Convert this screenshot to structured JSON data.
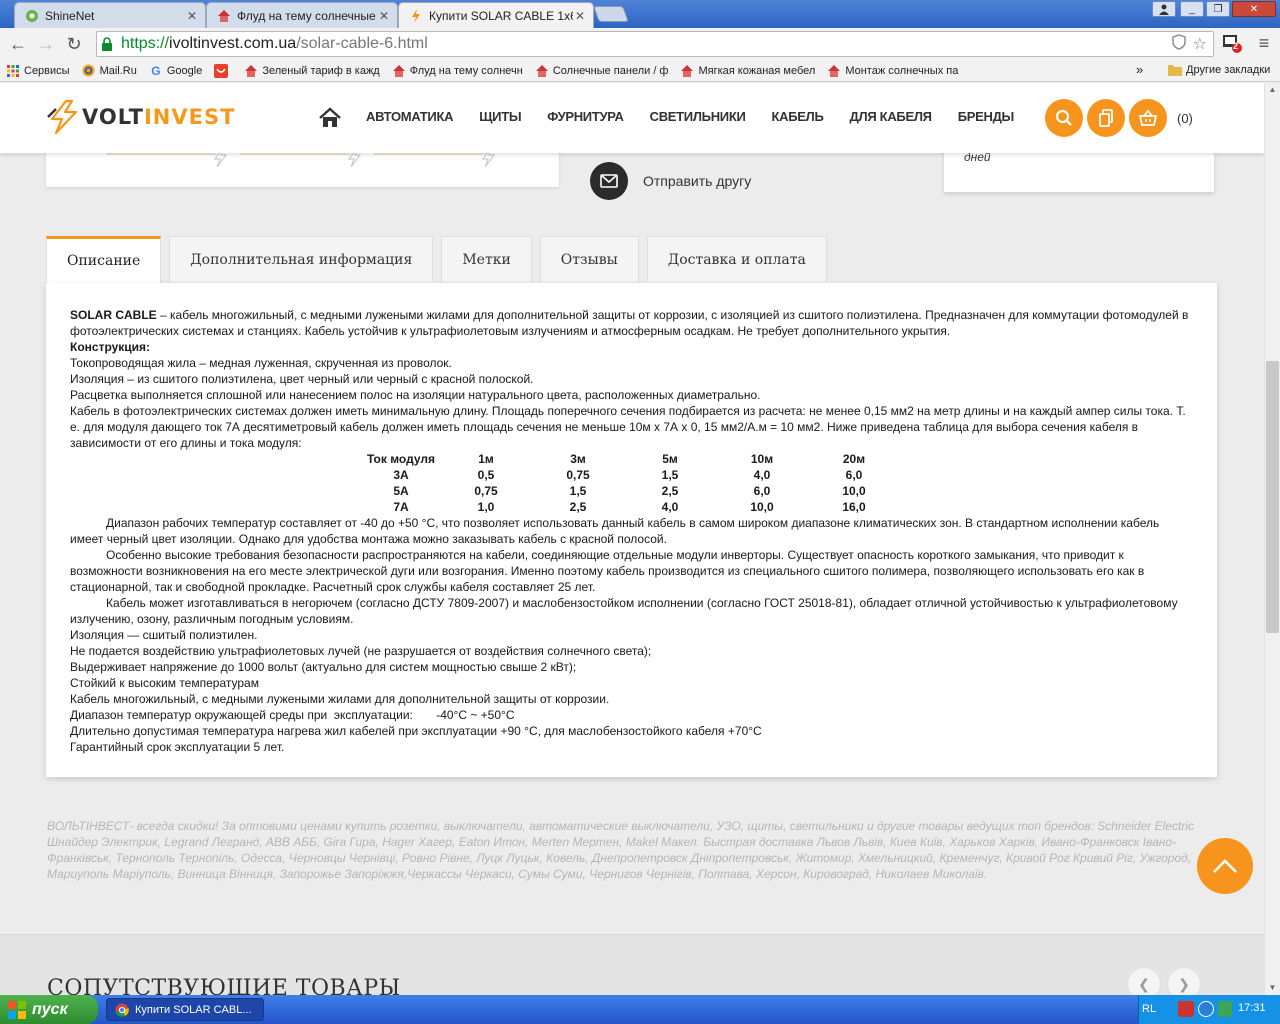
{
  "browser": {
    "tabs": [
      {
        "label": "ShineNet",
        "icon": "shinenet-icon"
      },
      {
        "label": "Флуд на тему солнечные б",
        "icon": "forum-icon"
      },
      {
        "label": "Купити SOLAR CABLE 1х6 К",
        "icon": "voltinvest-icon"
      }
    ],
    "url": {
      "scheme": "https://",
      "host": "ivoltinvest.com.ua",
      "path": "/solar-cable-6.html"
    },
    "extension_badge": "2",
    "bookmarks": [
      {
        "label": "Сервисы",
        "icon": "apps-icon"
      },
      {
        "label": "Mail.Ru",
        "icon": "mailru-icon"
      },
      {
        "label": "Google",
        "icon": "google-icon"
      },
      {
        "label": "",
        "icon": "aliexpress-icon"
      },
      {
        "label": "Зеленый тариф в кажд",
        "icon": "forum-icon"
      },
      {
        "label": "Флуд на тему солнечн",
        "icon": "forum-icon"
      },
      {
        "label": "Солнечные панели / ф",
        "icon": "forum-icon"
      },
      {
        "label": "Мягкая кожаная мебел",
        "icon": "forum-icon"
      },
      {
        "label": "Монтаж солнечных па",
        "icon": "forum-icon"
      }
    ],
    "bookmarks_more": "»",
    "other_bookmarks": "Другие закладки"
  },
  "site": {
    "logo_part1": "VOLT",
    "logo_part2": "INVEST",
    "nav": [
      "АВТОМАТИКА",
      "ЩИТЫ",
      "ФУРНИТУРА",
      "СВЕТИЛЬНИКИ",
      "КАБЕЛЬ",
      "ДЛЯ КАБЕЛЯ",
      "БРЕНДЫ"
    ],
    "cart_count": "(0)",
    "share_label": "Отправить другу",
    "side_card_text": "дней",
    "product_tabs": [
      "Описание",
      "Дополнительная информация",
      "Метки",
      "Отзывы",
      "Доставка и оплата"
    ],
    "active_tab": "Описание"
  },
  "description": {
    "intro_bold": "SOLAR CABLE",
    "intro_rest": " – кабель многожильный, с медными лужеными жилами для дополнительной защиты от коррозии, с изоляцией из сшитого полиэтилена. Предназначен для коммутации фотомодулей в фотоэлектрических системах и станциях. Кабель устойчив к ультрафиолетовым излучениям и атмосферным осадкам. Не требует дополнительного укрытия.",
    "construction_heading": "Конструкция:",
    "lines_a": [
      "Токопроводящая жила – медная луженная, скрученная из проволок.",
      "Изоляция – из сшитого полиэтилена, цвет черный или черный с красной полоской.",
      "Расцветка выполняется сплошной или нанесением полос на изоляции натурального цвета, расположенных диаметрально.",
      "Кабель в фотоэлектрических системах должен иметь минимальную длину. Площадь поперечного сечения подбирается из расчета: не менее 0,15 мм2 на метр длины и на каждый ампер силы тока. Т. е. для модуля дающего ток 7А десятиметровый кабель должен иметь площадь сечения не меньше 10м х 7А х 0, 15 мм2/А.м = 10 мм2. Ниже приведена таблица для выбора сечения кабеля в зависимости от его длины и тока модуля:"
    ],
    "table": {
      "headers": [
        "Ток модуля",
        "1м",
        "3м",
        "5м",
        "10м",
        "20м"
      ],
      "rows": [
        [
          "3А",
          "0,5",
          "0,75",
          "1,5",
          "4,0",
          "6,0"
        ],
        [
          "5А",
          "0,75",
          "1,5",
          "2,5",
          "6,0",
          "10,0"
        ],
        [
          "7А",
          "1,0",
          "2,5",
          "4,0",
          "10,0",
          "16,0"
        ]
      ]
    },
    "indented": [
      "Диапазон рабочих температур составляет от -40 до +50 °С, что позволяет использовать данный кабель в самом широком диапазоне климатических зон. В стандартном исполнении кабель имеет черный цвет изоляции. Однако для удобства монтажа можно заказывать кабель с красной полосой.",
      "Особенно высокие требования безопасности распространяются на кабели, соединяющие отдельные модули инверторы. Существует опасность короткого замыкания, что приводит к возможности возникновения на его месте электрической дуги или возгорания. Именно поэтому кабель производится из специального сшитого полимера, позволяющего использовать его как в стационарной, так и свободной прокладке. Расчетный срок службы кабеля составляет 25 лет.",
      "Кабель может изготавливаться в негорючем (согласно ДСТУ 7809-2007) и маслобензостойком исполнении (согласно ГОСТ 25018-81), обладает отличной устойчивостью к ультрафиолетовому излучению, озону, различным погодным условиям."
    ],
    "lines_b": [
      "Изоляция — сшитый полиэтилен.",
      "Не подается воздействию ультрафиолетовых лучей (не разрушается от воздействия солнечного света);",
      "Выдерживает напряжение до 1000 вольт (актуально для систем мощностью свыше 2 кВт);",
      "Стойкий к высоким температурам",
      "Кабель многожильный, с медными лужеными жилами для дополнительной защиты от коррозии.",
      "Диапазон температур окружающей среды при  эксплуатации:       -40°С ~ +50°С",
      "Длительно допустимая температура нагрева жил кабелей при эксплуатации +90 °С, для маслобензостойкого кабеля +70°С",
      "Гарантийный срок эксплуатации 5 лет."
    ]
  },
  "seo_text": "ВОЛЬТІНВЕСТ- всегда скидки! За оптовими ценами купить розетки, выключатели, автоматические выключатели, УЗО, щиты, светильники и другие товары ведущих топ брендов: Schneider Electric Шнайдер Электрик, Legrand Легранд, ABB АББ, Gira Гира, Hager Хагер, Eaton Итон, Merten Мертен, Makel Макел. Быстрая доставка Львов Львів, Киев Київ, Харьков Харків, Ивано-Франковск Івано-Франківськ, Тернополь Тернопіль, Одесса, Черновцы Чернівці, Ровно Рівне, Луцк Луцьк, Ковель, Днепропетровск Дніпропетровськ, Житомир, Хмельницкий, Кременчуг, Кривой Рог Кривий Ріг, Ужгород, Мариуполь Маріуполь, Винница Вінниця, Запорожье Запоріжжя,Черкассы Черкаси, Сумы Суми, Чернигов Чернігів, Полтава, Херсон, Кировоград, Николаев Миколаїв.",
  "related_title": "СОПУТСТВУЮЩИЕ ТОВАРЫ",
  "taskbar": {
    "start_label": "пуск",
    "task_item": "Купити SOLAR CABL...",
    "language": "RL",
    "clock": "17:31"
  },
  "colors": {
    "accent": "#f7941d",
    "dark": "#2b2b2b",
    "seo": "#b5b5b5"
  }
}
